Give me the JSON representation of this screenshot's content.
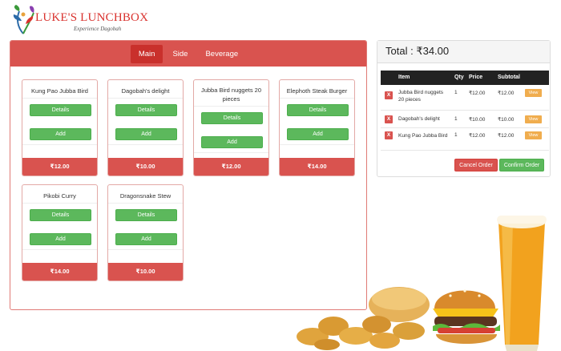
{
  "brand": {
    "title": "LUKE'S LUNCHBOX",
    "subtitle": "Experience Dagobah"
  },
  "menu": {
    "tabs": [
      {
        "label": "Main",
        "active": true
      },
      {
        "label": "Side",
        "active": false
      },
      {
        "label": "Beverage",
        "active": false
      }
    ],
    "details_label": "Details",
    "add_label": "Add",
    "items": [
      {
        "name": "Kung Pao Jubba Bird",
        "price": "₹12.00"
      },
      {
        "name": "Dagobah's delight",
        "price": "₹10.00"
      },
      {
        "name": "Jubba Bird nuggets 20 pieces",
        "price": "₹12.00"
      },
      {
        "name": "Elephoth Steak Burger",
        "price": "₹14.00"
      },
      {
        "name": "Pikobi Curry",
        "price": "₹14.00"
      },
      {
        "name": "Dragonsnake Stew",
        "price": "₹10.00"
      }
    ]
  },
  "order": {
    "total_label": "Total :",
    "total_value": "₹34.00",
    "columns": {
      "item": "Item",
      "qty": "Qty",
      "price": "Price",
      "subtotal": "Subtotal"
    },
    "remove_label": "X",
    "view_label": "View",
    "rows": [
      {
        "item": "Jubba Bird nuggets 20 pieces",
        "qty": "1",
        "price": "₹12.00",
        "subtotal": "₹12.00"
      },
      {
        "item": "Dagobah's delight",
        "qty": "1",
        "price": "₹10.00",
        "subtotal": "₹10.00"
      },
      {
        "item": "Kung Pao Jubba Bird",
        "qty": "1",
        "price": "₹12.00",
        "subtotal": "₹12.00"
      }
    ],
    "cancel_label": "Cancel Order",
    "confirm_label": "Confirm Order"
  },
  "colors": {
    "accent_red": "#d9534f",
    "accent_green": "#5cb85c",
    "accent_orange": "#f0ad4e",
    "header_dark": "#222222"
  },
  "decor": {
    "icons": [
      "lunchbox-logo-icon",
      "chicken-nuggets-image",
      "burger-image",
      "beer-glass-image"
    ]
  }
}
